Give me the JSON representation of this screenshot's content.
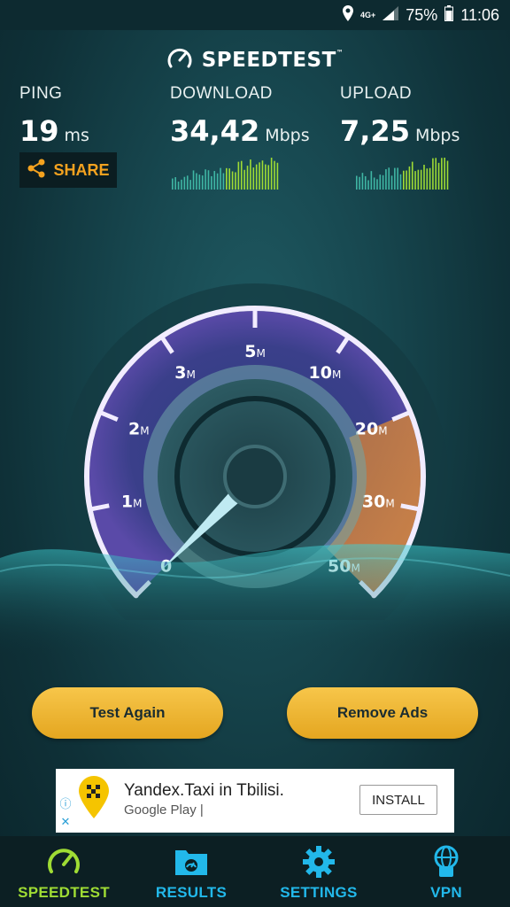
{
  "status_bar": {
    "network": "4G+",
    "battery": "75%",
    "time": "11:06"
  },
  "app": {
    "title": "SPEEDTEST",
    "tm": "™"
  },
  "ping": {
    "label": "PING",
    "value": "19",
    "unit": "ms"
  },
  "download": {
    "label": "DOWNLOAD",
    "value": "34,42",
    "unit": "Mbps"
  },
  "upload": {
    "label": "UPLOAD",
    "value": "7,25",
    "unit": "Mbps"
  },
  "share_label": "SHARE",
  "gauge": {
    "ticks": [
      {
        "num": "0",
        "suffix": ""
      },
      {
        "num": "1",
        "suffix": "M"
      },
      {
        "num": "2",
        "suffix": "M"
      },
      {
        "num": "3",
        "suffix": "M"
      },
      {
        "num": "5",
        "suffix": "M"
      },
      {
        "num": "10",
        "suffix": "M"
      },
      {
        "num": "20",
        "suffix": "M"
      },
      {
        "num": "30",
        "suffix": "M"
      },
      {
        "num": "50",
        "suffix": "M"
      }
    ],
    "needle_value": "0"
  },
  "buttons": {
    "test_again": "Test Again",
    "remove_ads": "Remove Ads"
  },
  "ad": {
    "title": "Yandex.Taxi in Tbilisi.",
    "subtitle": "Google Play",
    "install": "INSTALL"
  },
  "nav": [
    {
      "label": "SPEEDTEST",
      "icon": "speedometer-icon",
      "active": true
    },
    {
      "label": "RESULTS",
      "icon": "results-icon",
      "active": false
    },
    {
      "label": "SETTINGS",
      "icon": "gear-icon",
      "active": false
    },
    {
      "label": "VPN",
      "icon": "vpn-globe-icon",
      "active": false
    }
  ],
  "colors": {
    "accent_orange": "#f4a21f",
    "nav_active": "#9fdc34",
    "nav_inactive": "#22b8ea",
    "button_gold": "#f0b837"
  }
}
